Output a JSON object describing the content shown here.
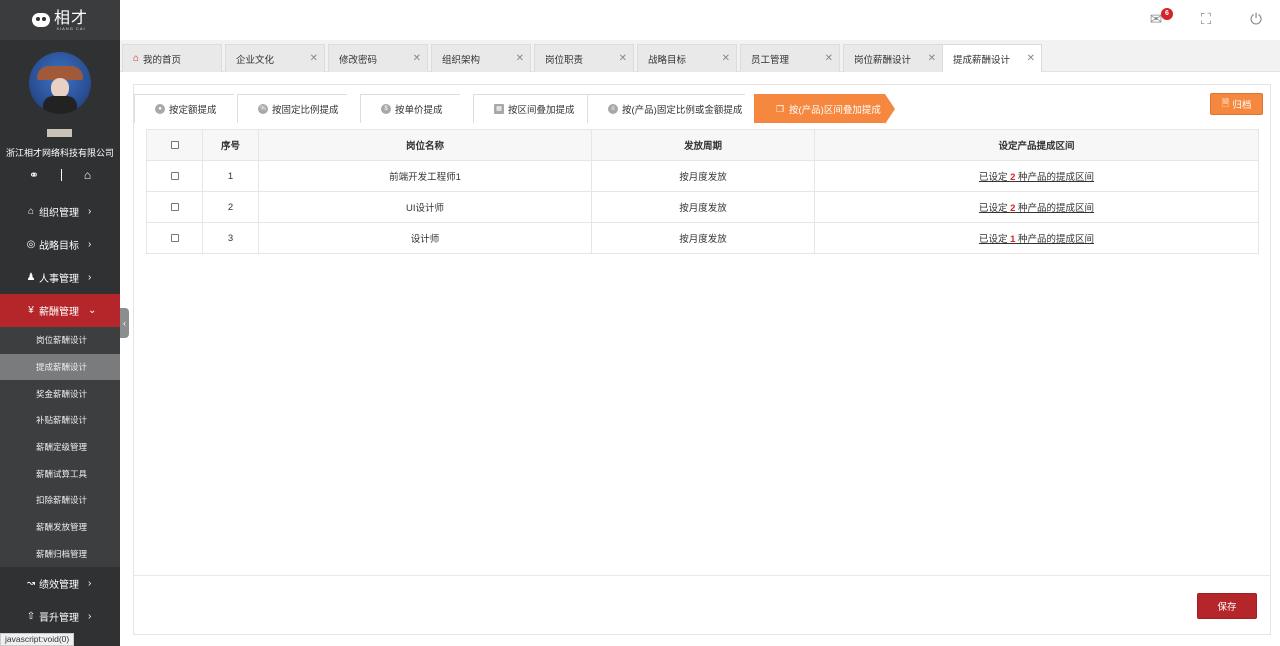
{
  "brand": {
    "logo_text": "相才",
    "logo_sub": "XIANG CAI"
  },
  "user": {
    "company": "浙江相才网络科技有限公司"
  },
  "sidebar": {
    "menu": [
      {
        "icon": "org-icon",
        "label": "组织管理"
      },
      {
        "icon": "target-icon",
        "label": "战略目标"
      },
      {
        "icon": "person-icon",
        "label": "人事管理"
      },
      {
        "icon": "yen-icon",
        "label": "薪酬管理",
        "active": true
      }
    ],
    "submenu": [
      "岗位薪酬设计",
      "提成薪酬设计",
      "奖金薪酬设计",
      "补贴薪酬设计",
      "薪酬定级管理",
      "薪酬试算工具",
      "扣除薪酬设计",
      "薪酬发放管理",
      "薪酬归档管理"
    ],
    "menu_after": [
      {
        "icon": "chart-icon",
        "label": "绩效管理"
      },
      {
        "icon": "promote-icon",
        "label": "晋升管理"
      }
    ],
    "status_url": "javascript:void(0)"
  },
  "topbar": {
    "message_badge": "6"
  },
  "tabs": [
    {
      "label": "我的首页",
      "home": true
    },
    {
      "label": "企业文化"
    },
    {
      "label": "修改密码"
    },
    {
      "label": "组织架构"
    },
    {
      "label": "岗位职责"
    },
    {
      "label": "战略目标"
    },
    {
      "label": "员工管理"
    },
    {
      "label": "岗位薪酬设计"
    },
    {
      "label": "提成薪酬设计",
      "active": true
    }
  ],
  "subtabs": [
    {
      "label": "按定额提成"
    },
    {
      "label": "按固定比例提成"
    },
    {
      "label": "按单价提成"
    },
    {
      "label": "按区间叠加提成"
    },
    {
      "label": "按(产品)固定比例或金额提成"
    },
    {
      "label": "按(产品)区间叠加提成",
      "active": true
    }
  ],
  "buttons": {
    "archive": "归档",
    "save": "保存"
  },
  "table": {
    "headers": [
      "",
      "序号",
      "岗位名称",
      "发放周期",
      "设定产品提成区间"
    ],
    "rows": [
      {
        "no": "1",
        "position": "前端开发工程师1",
        "cycle": "按月度发放",
        "prefix": "已设定",
        "count": "2",
        "suffix": "种产品的提成区间"
      },
      {
        "no": "2",
        "position": "UI设计师",
        "cycle": "按月度发放",
        "prefix": "已设定",
        "count": "2",
        "suffix": "种产品的提成区间"
      },
      {
        "no": "3",
        "position": "设计师",
        "cycle": "按月度发放",
        "prefix": "已设定",
        "count": "1",
        "suffix": "种产品的提成区间"
      }
    ]
  },
  "colors": {
    "primary_red": "#b5262b",
    "accent_orange": "#f5883e",
    "badge_red": "#d4232a"
  }
}
